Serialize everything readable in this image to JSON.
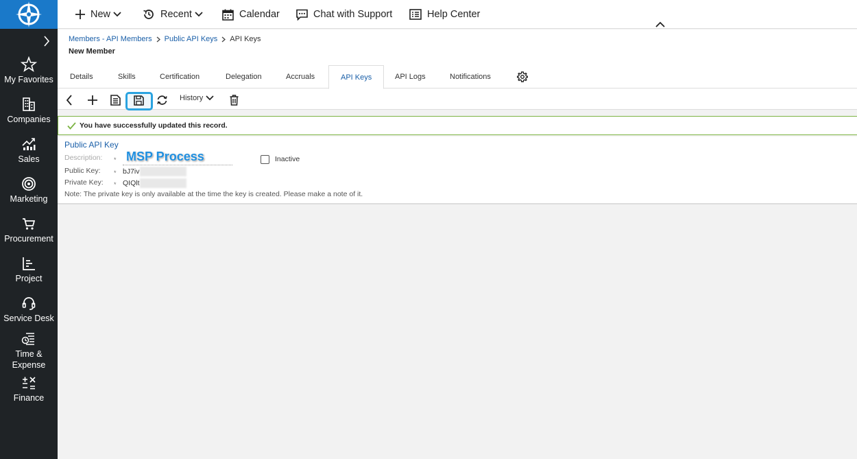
{
  "sidebar": {
    "items": [
      {
        "label": "My Favorites",
        "icon": "star-icon"
      },
      {
        "label": "Companies",
        "icon": "building-icon"
      },
      {
        "label": "Sales",
        "icon": "chart-icon"
      },
      {
        "label": "Marketing",
        "icon": "target-icon"
      },
      {
        "label": "Procurement",
        "icon": "cart-icon"
      },
      {
        "label": "Project",
        "icon": "project-icon"
      },
      {
        "label": "Service Desk",
        "icon": "headset-icon"
      },
      {
        "label": "Time &",
        "label2": "Expense",
        "icon": "time-expense-icon"
      },
      {
        "label": "Finance",
        "icon": "finance-icon"
      }
    ]
  },
  "topbar": {
    "new": "New",
    "recent": "Recent",
    "calendar": "Calendar",
    "chat": "Chat with Support",
    "help": "Help Center"
  },
  "breadcrumb": {
    "link1": "Members - API Members",
    "link2": "Public API Keys",
    "current": "API Keys"
  },
  "page_title": "New Member",
  "tabs": [
    {
      "label": "Details"
    },
    {
      "label": "Skills"
    },
    {
      "label": "Certification"
    },
    {
      "label": "Delegation"
    },
    {
      "label": "Accruals"
    },
    {
      "label": "API Keys",
      "active": true
    },
    {
      "label": "API Logs"
    },
    {
      "label": "Notifications"
    }
  ],
  "toolbar": {
    "history_label": "History"
  },
  "success_message": "You have successfully updated this record.",
  "form": {
    "section_title": "Public API Key",
    "description_label": "Description:",
    "description_value": "MSP Process",
    "public_key_label": "Public Key:",
    "public_key_value": "bJ7iv",
    "private_key_label": "Private Key:",
    "private_key_value": "QIQlt",
    "required_mark": "*",
    "inactive_label": "Inactive",
    "note": "Note: The private key is only available at the time the key is created. Please make a note of it."
  },
  "colors": {
    "sidebar_bg": "#1f2326",
    "logo_bg": "#1a79c9",
    "link": "#1a5fa8",
    "highlight": "#2aa3e0",
    "success_border": "#7cb342"
  }
}
